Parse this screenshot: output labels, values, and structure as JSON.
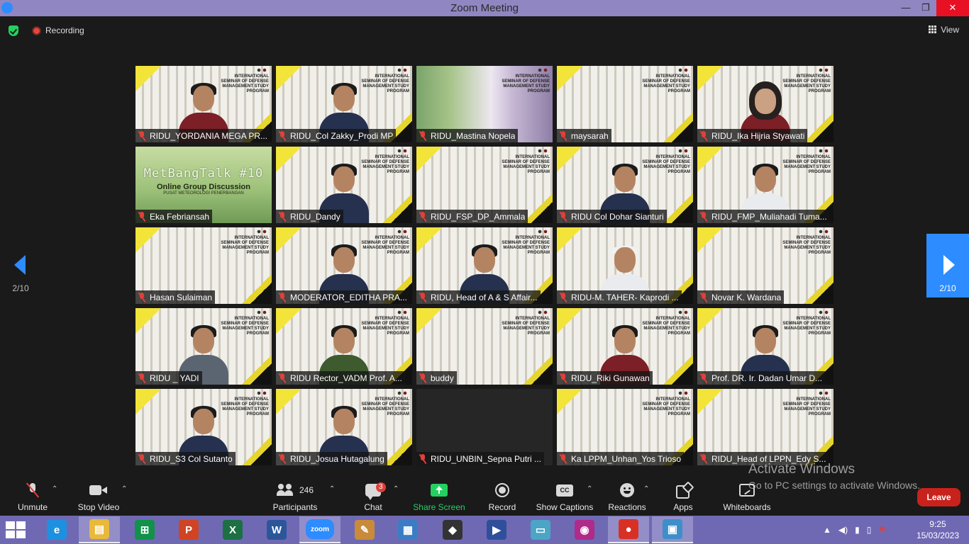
{
  "window": {
    "title": "Zoom Meeting",
    "controls": {
      "minimize": "—",
      "restore": "❐",
      "close": "✕"
    }
  },
  "topbar": {
    "recording_label": "Recording",
    "view_label": "View"
  },
  "gallery": {
    "tiles": [
      {
        "name": "RIDU_YORDANIA MEGA PR...",
        "bg": "building",
        "person": "red",
        "banner": true
      },
      {
        "name": "RIDU_Col Zakky_Prodi MP",
        "bg": "building",
        "person": "navy",
        "banner": true
      },
      {
        "name": "RIDU_Mastina Nopela",
        "bg": "blur",
        "person": "",
        "banner": true
      },
      {
        "name": "maysarah",
        "bg": "building",
        "person": "",
        "banner": true
      },
      {
        "name": "RIDU_Ika Hijria Styawati",
        "bg": "building",
        "person": "hijab red",
        "banner": true
      },
      {
        "name": "Eka Febriansah",
        "bg": "green",
        "person": "",
        "banner": false
      },
      {
        "name": "RIDU_Dandy",
        "bg": "building",
        "person": "navy",
        "banner": true
      },
      {
        "name": "RIDU_FSP_DP_Ammala",
        "bg": "building",
        "person": "",
        "banner": true
      },
      {
        "name": "RIDU Col Dohar Sianturi",
        "bg": "building",
        "person": "navy",
        "banner": true
      },
      {
        "name": "RIDU_FMP_Muliahadi Tuma...",
        "bg": "building",
        "person": "white",
        "banner": true
      },
      {
        "name": "Hasan Sulaiman",
        "bg": "building",
        "person": "",
        "banner": true
      },
      {
        "name": "MODERATOR_EDITHA PRA...",
        "bg": "building",
        "person": "navy",
        "banner": true
      },
      {
        "name": "RIDU, Head of A & S Affair...",
        "bg": "building",
        "person": "navy",
        "banner": true
      },
      {
        "name": "RIDU-M. TAHER- Kaprodi ...",
        "bg": "building",
        "person": "white cap",
        "banner": false
      },
      {
        "name": "Novar K. Wardana",
        "bg": "building",
        "person": "",
        "banner": true
      },
      {
        "name": "RIDU _ YADI",
        "bg": "building",
        "person": "grey",
        "banner": true
      },
      {
        "name": "RIDU Rector_VADM Prof. A...",
        "bg": "building",
        "person": "green",
        "banner": true
      },
      {
        "name": "buddy",
        "bg": "building",
        "person": "",
        "banner": true
      },
      {
        "name": "RIDU_Riki Gunawan",
        "bg": "building",
        "person": "red",
        "banner": true
      },
      {
        "name": "Prof. DR. Ir. Dadan Umar D...",
        "bg": "building",
        "person": "navy",
        "banner": true
      },
      {
        "name": "RIDU_S3 Col Sutanto",
        "bg": "building",
        "person": "navy",
        "banner": true
      },
      {
        "name": "RIDU_Josua Hutagalung",
        "bg": "building",
        "person": "navy",
        "banner": true
      },
      {
        "name": "RIDU_UNBIN_Sepna Putri ...",
        "bg": "blank",
        "person": "",
        "banner": false
      },
      {
        "name": "Ka LPPM_Unhan_Yos Trioso",
        "bg": "building",
        "person": "",
        "banner": true
      },
      {
        "name": "RIDU_Head of LPPN_Edy S...",
        "bg": "building",
        "person": "",
        "banner": true
      }
    ],
    "banner_text": "INTERNATIONAL SEMINAR OF DEFENSE MANAGEMENT STUDY PROGRAM",
    "metbang": {
      "title": "MetBangTalk #10",
      "subtitle": "Online Group Discussion",
      "subtitle2": "PUSAT METEOROLOGI PENERBANGAN"
    }
  },
  "pagination": {
    "left_page": "2/10",
    "right_page": "2/10"
  },
  "toolbar": {
    "unmute": "Unmute",
    "stop_video": "Stop Video",
    "participants_count": "246",
    "participants": "Participants",
    "chat": "Chat",
    "chat_badge": "3",
    "share_screen": "Share Screen",
    "record": "Record",
    "show_captions": "Show Captions",
    "captions_icon_text": "CC",
    "reactions": "Reactions",
    "apps": "Apps",
    "whiteboards": "Whiteboards",
    "leave": "Leave",
    "caret": "⌃"
  },
  "watermark": {
    "line1": "Activate Windows",
    "line2": "Go to PC settings to activate Windows."
  },
  "taskbar": {
    "apps": [
      {
        "name": "ie",
        "glyph": "e",
        "color": "#1e90e0"
      },
      {
        "name": "explorer",
        "glyph": "▤",
        "color": "#e8b93a"
      },
      {
        "name": "store",
        "glyph": "⊞",
        "color": "#11914a"
      },
      {
        "name": "powerpoint",
        "glyph": "P",
        "color": "#d04423"
      },
      {
        "name": "excel",
        "glyph": "X",
        "color": "#1d7044"
      },
      {
        "name": "word",
        "glyph": "W",
        "color": "#2b579a"
      },
      {
        "name": "zoom",
        "glyph": "zoom",
        "color": "#2d8cff"
      },
      {
        "name": "paint",
        "glyph": "✎",
        "color": "#c98b3a"
      },
      {
        "name": "calculator",
        "glyph": "▦",
        "color": "#3b7dc4"
      },
      {
        "name": "inkscape",
        "glyph": "◆",
        "color": "#333333"
      },
      {
        "name": "media",
        "glyph": "▶",
        "color": "#2f4f9a"
      },
      {
        "name": "notes",
        "glyph": "▭",
        "color": "#4aa5c6"
      },
      {
        "name": "camera",
        "glyph": "◉",
        "color": "#b02a8a"
      },
      {
        "name": "chrome",
        "glyph": "●",
        "color": "#d93025"
      },
      {
        "name": "photos",
        "glyph": "▣",
        "color": "#3d8fc9"
      }
    ],
    "time": "9:25",
    "date": "15/03/2023"
  }
}
